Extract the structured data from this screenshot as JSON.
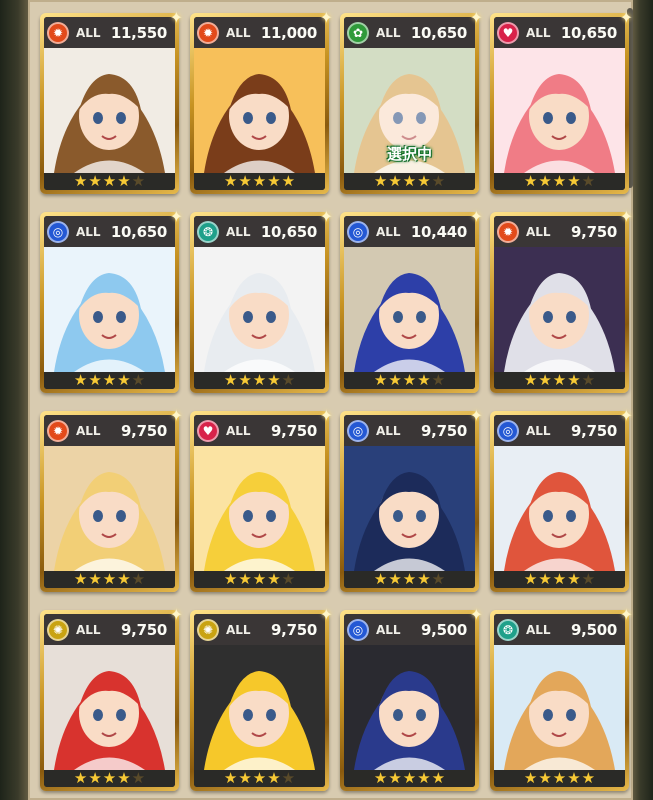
{
  "labels": {
    "all": "ALL",
    "selected": "選択中"
  },
  "colors": {
    "fire": "#e24a1a",
    "leaf": "#2f9a3a",
    "heart": "#d8224a",
    "water": "#2458d4",
    "wind": "#1fa08a",
    "light": "#c9a312"
  },
  "cards": [
    {
      "element": "fire",
      "icon": "fire-icon",
      "power": "11,550",
      "stars": 4,
      "selected": false,
      "hair": "#8a5a2c",
      "bg": "#f1ece4"
    },
    {
      "element": "fire",
      "icon": "fire-icon",
      "power": "11,000",
      "stars": 5,
      "selected": false,
      "hair": "#7a3d1a",
      "bg": "#f7c05a"
    },
    {
      "element": "leaf",
      "icon": "leaf-icon",
      "power": "10,650",
      "stars": 4,
      "selected": true,
      "hair": "#d6a24e",
      "bg": "#b9c9a0"
    },
    {
      "element": "heart",
      "icon": "heart-icon",
      "power": "10,650",
      "stars": 4,
      "selected": false,
      "hair": "#f07c86",
      "bg": "#fde4e8"
    },
    {
      "element": "water",
      "icon": "water-icon",
      "power": "10,650",
      "stars": 4,
      "selected": false,
      "hair": "#8ec9ef",
      "bg": "#eaf4fb"
    },
    {
      "element": "wind",
      "icon": "wind-icon",
      "power": "10,650",
      "stars": 4,
      "selected": false,
      "hair": "#e8ecf0",
      "bg": "#f3f3f3"
    },
    {
      "element": "water",
      "icon": "water-icon",
      "power": "10,440",
      "stars": 4,
      "selected": false,
      "hair": "#2d3fa8",
      "bg": "#d3c9b2"
    },
    {
      "element": "fire",
      "icon": "fire-icon",
      "power": "9,750",
      "stars": 4,
      "selected": false,
      "hair": "#e0e0e8",
      "bg": "#3c2f52"
    },
    {
      "element": "fire",
      "icon": "fire-icon",
      "power": "9,750",
      "stars": 4,
      "selected": false,
      "hair": "#f2cf76",
      "bg": "#ecd3a6"
    },
    {
      "element": "heart",
      "icon": "heart-icon",
      "power": "9,750",
      "stars": 4,
      "selected": false,
      "hair": "#f6cf3a",
      "bg": "#fbe3a2"
    },
    {
      "element": "water",
      "icon": "water-icon",
      "power": "9,750",
      "stars": 4,
      "selected": false,
      "hair": "#1c2b5a",
      "bg": "#29407a"
    },
    {
      "element": "water",
      "icon": "water-icon",
      "power": "9,750",
      "stars": 4,
      "selected": false,
      "hair": "#e0553c",
      "bg": "#e8eef4"
    },
    {
      "element": "light",
      "icon": "light-icon",
      "power": "9,750",
      "stars": 4,
      "selected": false,
      "hair": "#d8332e",
      "bg": "#e7dfd8"
    },
    {
      "element": "light",
      "icon": "light-icon",
      "power": "9,750",
      "stars": 4,
      "selected": false,
      "hair": "#f6c82a",
      "bg": "#2f2f2f"
    },
    {
      "element": "water",
      "icon": "water-icon",
      "power": "9,500",
      "stars": 5,
      "selected": false,
      "hair": "#2a3a8c",
      "bg": "#2a2a30"
    },
    {
      "element": "wind",
      "icon": "wind-icon",
      "power": "9,500",
      "stars": 5,
      "selected": false,
      "hair": "#e3a75a",
      "bg": "#d9eaf5"
    }
  ]
}
